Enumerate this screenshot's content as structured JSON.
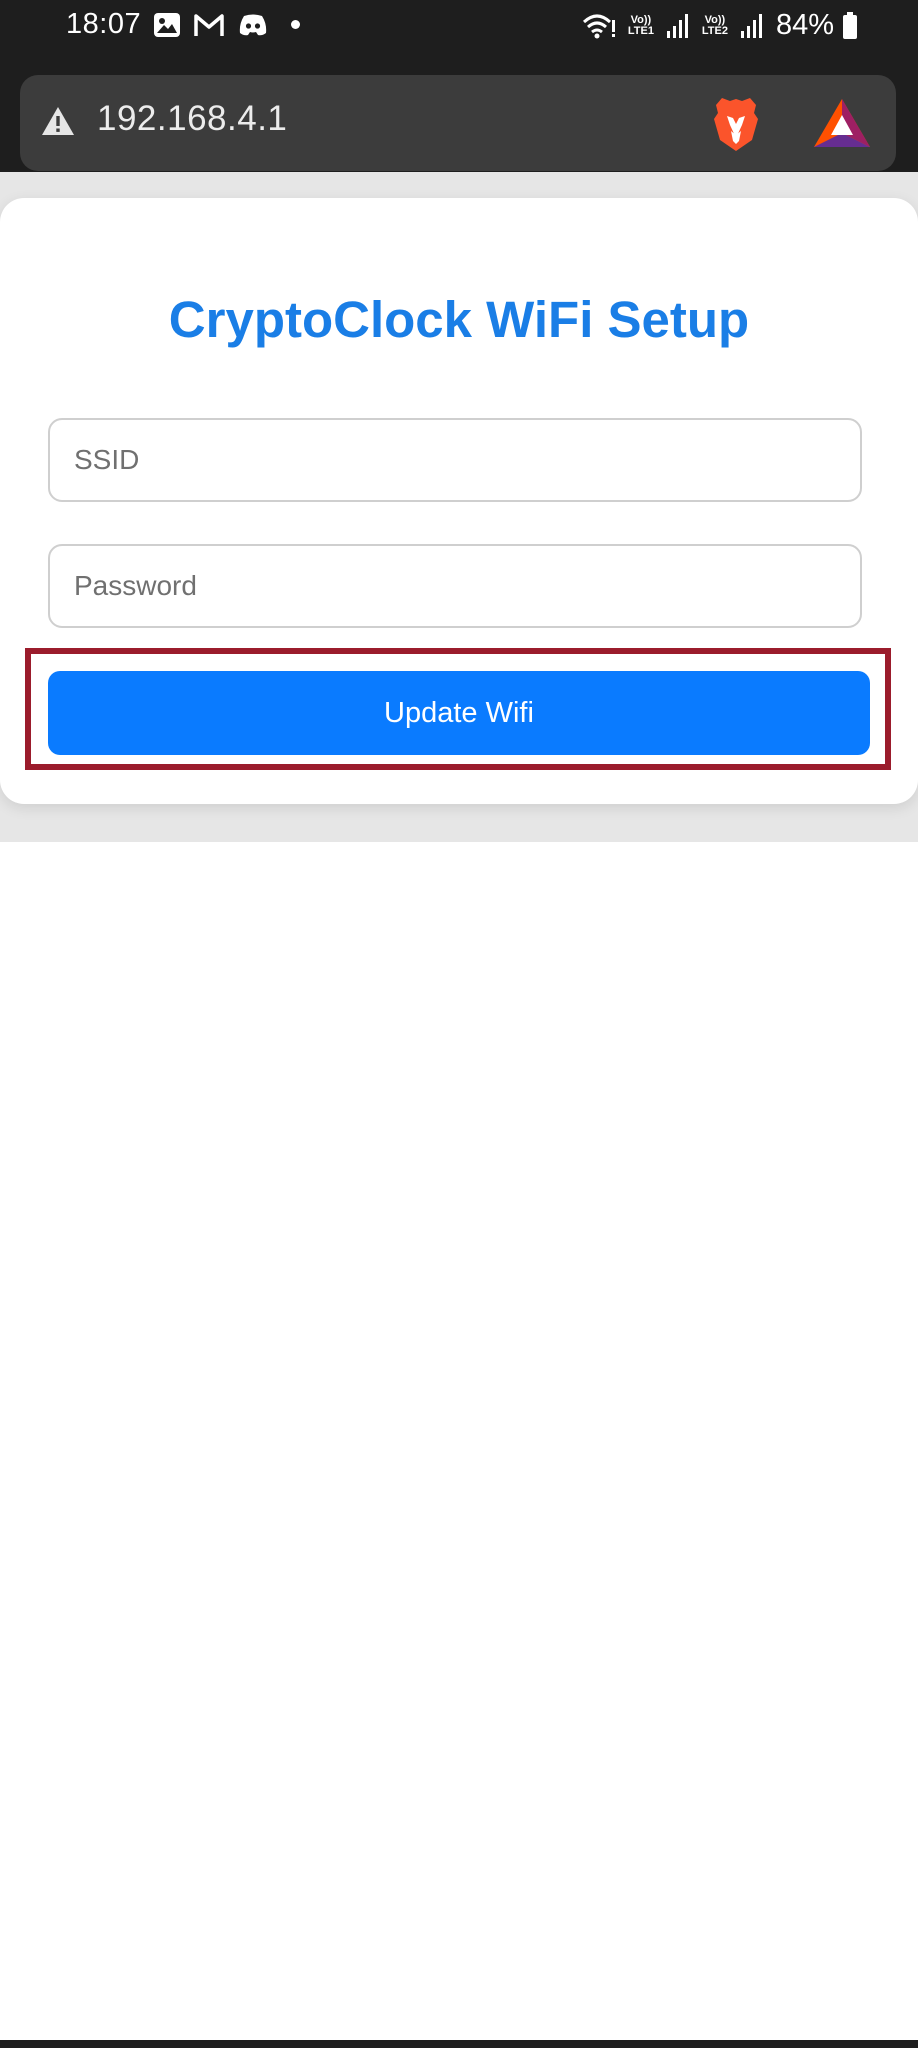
{
  "status_bar": {
    "time": "18:07",
    "battery": "84%",
    "sim1_label": "Vo)) LTE1",
    "sim2_label": "Vo)) LTE2",
    "left_icons": [
      "gallery-icon",
      "gmail-icon",
      "discord-icon",
      "notification-dot"
    ],
    "right_icons": [
      "wifi-icon",
      "signal-icon",
      "signal-icon",
      "battery-icon"
    ]
  },
  "browser": {
    "url": "192.168.4.1",
    "icons": [
      "warning-icon",
      "brave-shield-icon",
      "bat-rewards-icon"
    ]
  },
  "form": {
    "title": "CryptoClock WiFi Setup",
    "ssid_placeholder": "SSID",
    "ssid_value": "",
    "password_placeholder": "Password",
    "password_value": "",
    "submit_label": "Update Wifi"
  },
  "colors": {
    "title": "#1a7ee6",
    "button": "#0a7bff",
    "highlight_box": "#9b1c2c",
    "status_bar": "#1e1e1e",
    "url_pill": "#3c3c3c",
    "page_background": "#e6e6e6"
  }
}
